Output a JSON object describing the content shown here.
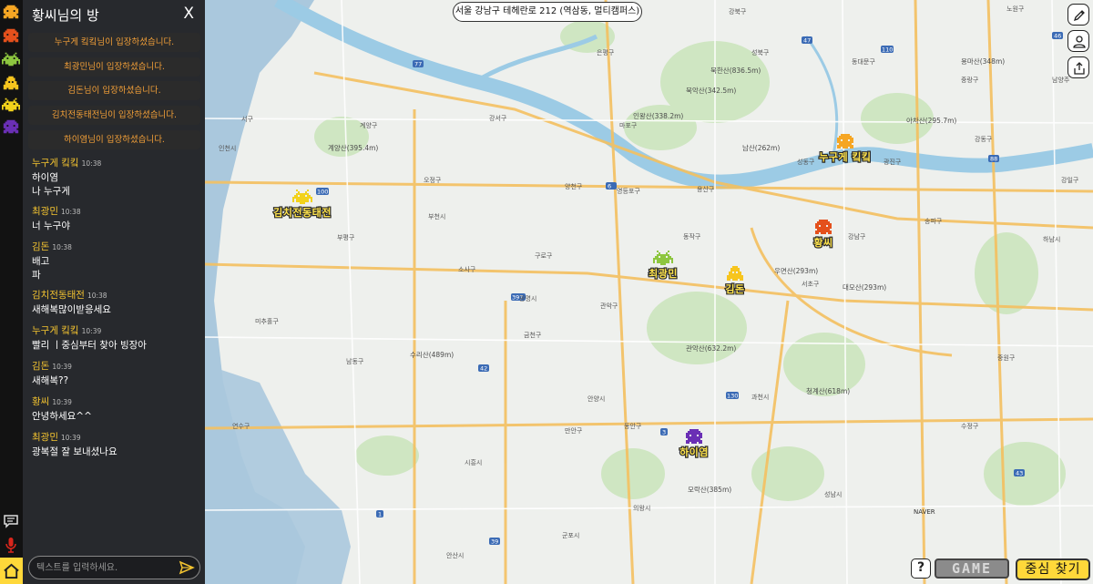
{
  "room": {
    "title": "황씨님의 방",
    "close_label": "X"
  },
  "notices": [
    "누구게 킼킼님이 입장하셨습니다.",
    "최광민님이 입장하셨습니다.",
    "김돈님이 입장하셨습니다.",
    "김치전동태전님이 입장하셨습니다.",
    "하이염님이 입장하셨습니다."
  ],
  "messages": [
    {
      "name": "누구게 킼킼",
      "time": "10:38",
      "lines": [
        "하이염",
        "나 누구게"
      ]
    },
    {
      "name": "최광민",
      "time": "10:38",
      "lines": [
        "너 누구야"
      ]
    },
    {
      "name": "김돈",
      "time": "10:38",
      "lines": [
        "배고",
        "파"
      ]
    },
    {
      "name": "김치전동태전",
      "time": "10:38",
      "lines": [
        "새해복많이받응세요"
      ]
    },
    {
      "name": "누구게 킼킼",
      "time": "10:39",
      "lines": [
        "빨리 ㅣ중심부터 찾아 빙장아"
      ]
    },
    {
      "name": "김돈",
      "time": "10:39",
      "lines": [
        "새해복??"
      ]
    },
    {
      "name": "황씨",
      "time": "10:39",
      "lines": [
        "안녕하세요^^"
      ]
    },
    {
      "name": "최광민",
      "time": "10:39",
      "lines": [
        "광복절 잘 보내셨나요"
      ]
    }
  ],
  "chat_input": {
    "placeholder": "텍스트를 입력하세요."
  },
  "address": "서울 강남구 테헤란로 212 (역삼동, 멀티캠퍼스)",
  "players": [
    {
      "name": "누구게 킼킼",
      "color": "#f6a623"
    },
    {
      "name": "김치전동태전",
      "color": "#f2d21b"
    },
    {
      "name": "황씨",
      "color": "#e4501c"
    },
    {
      "name": "최광민",
      "color": "#8dc63f"
    },
    {
      "name": "김돈",
      "color": "#f7c51e"
    },
    {
      "name": "하이염",
      "color": "#6a2fb5"
    }
  ],
  "map": {
    "district_labels": [
      "서구",
      "계양구",
      "강서구",
      "마포구",
      "용산구",
      "은평구",
      "성북구",
      "강북구",
      "동대문구",
      "중랑구",
      "성동구",
      "광진구",
      "송파구",
      "강동구",
      "강남구",
      "서초구",
      "동작구",
      "관악구",
      "금천구",
      "구로구",
      "영등포구",
      "양천구",
      "부평구",
      "부천시",
      "남동구",
      "연수구",
      "미추홀구",
      "소사구",
      "오정구",
      "광명시",
      "안양시",
      "과천시",
      "성남시",
      "의왕시",
      "군포시",
      "시흥시",
      "안산시",
      "하남시",
      "중원구",
      "수정구",
      "만안구",
      "동안구",
      "강일구",
      "남양주",
      "인천시",
      "노원구"
    ],
    "mountain_labels": [
      "북한산(836.5m)",
      "북악산(342.5m)",
      "인왕산(338.2m)",
      "남산(262m)",
      "관악산(632.2m)",
      "우면산(293m)",
      "청계산(618m)",
      "아차산(295.7m)",
      "용마산(348m)",
      "계양산(395.4m)",
      "수리산(489m)",
      "모락산(385m)",
      "대모산(293m)"
    ],
    "road_numbers": [
      "77",
      "6",
      "100",
      "110",
      "130",
      "1",
      "39",
      "42",
      "47",
      "3",
      "43",
      "46",
      "397",
      "88"
    ],
    "naver_label": "NAVER"
  },
  "buttons": {
    "help": "?",
    "game": "GAME",
    "center": "중심 찾기"
  },
  "icons": {
    "side": [
      "pencil-icon",
      "profile-icon",
      "share-icon"
    ],
    "strip_tools": [
      "chat-icon",
      "microphone-icon",
      "home-icon"
    ]
  },
  "colors": {
    "panel_bg": "#181a1e",
    "notice_text": "#f29f38",
    "name_text": "#f4c430",
    "river": "#9ccbe5",
    "sea": "#aac8dd",
    "center_button": "#ffd83a"
  }
}
